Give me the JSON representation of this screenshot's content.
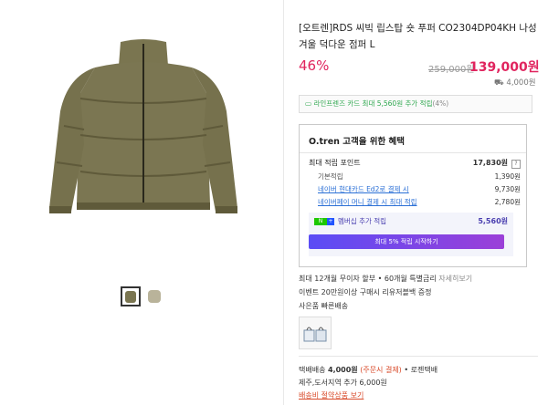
{
  "product": {
    "title": "[오트렌]RDS 씨빅 립스탑 숏 푸퍼 CO2304DP04KH 나성 겨울 덕다운 점퍼 L",
    "discount": "46%",
    "original_price": "259,000원",
    "price": "139,000원",
    "shipping_amount": "4,000원"
  },
  "card_banner": {
    "label": "라인프렌즈 카드 최대 5,560원 추가 적립",
    "suffix": "(4%)"
  },
  "benefit": {
    "title": "O.tren 고객을 위한 혜택",
    "max_points_label": "최대 적립 포인트",
    "max_points_value": "17,830원",
    "rows": [
      {
        "label": "기본적립",
        "value": "1,390원"
      },
      {
        "label": "네이버 현대카드 Ed2로 결제 시",
        "value": "9,730원"
      },
      {
        "label": "네이버페이 머니 결제 시 최대 적립",
        "value": "2,780원"
      }
    ],
    "membership_label": "멤버십 추가 적립",
    "membership_value": "5,560원",
    "membership_button": "최대 5% 적립 시작하기"
  },
  "info": {
    "installment": "최대 12개월 무이자 할부 • 60개월 특별금리",
    "installment_link": "자세히보기",
    "event_label": "이벤트",
    "event_text": "20만원이상 구매시 리유저블백 증정",
    "gift_label": "사은품",
    "gift_text": "빠른배송",
    "delivery_label": "택배배송",
    "delivery_price": "4,000원",
    "delivery_cond": "(주문시 결제)",
    "delivery_type": "• 로젠택배",
    "extra_fee": "제주,도서지역 추가 6,000원",
    "bundle_link": "배송비 절약상품 보기"
  },
  "colors": {
    "accent": "#e0245e",
    "naver_green": "#1ec800",
    "purple": "#5b4df5",
    "jacket": "#7a7550"
  }
}
